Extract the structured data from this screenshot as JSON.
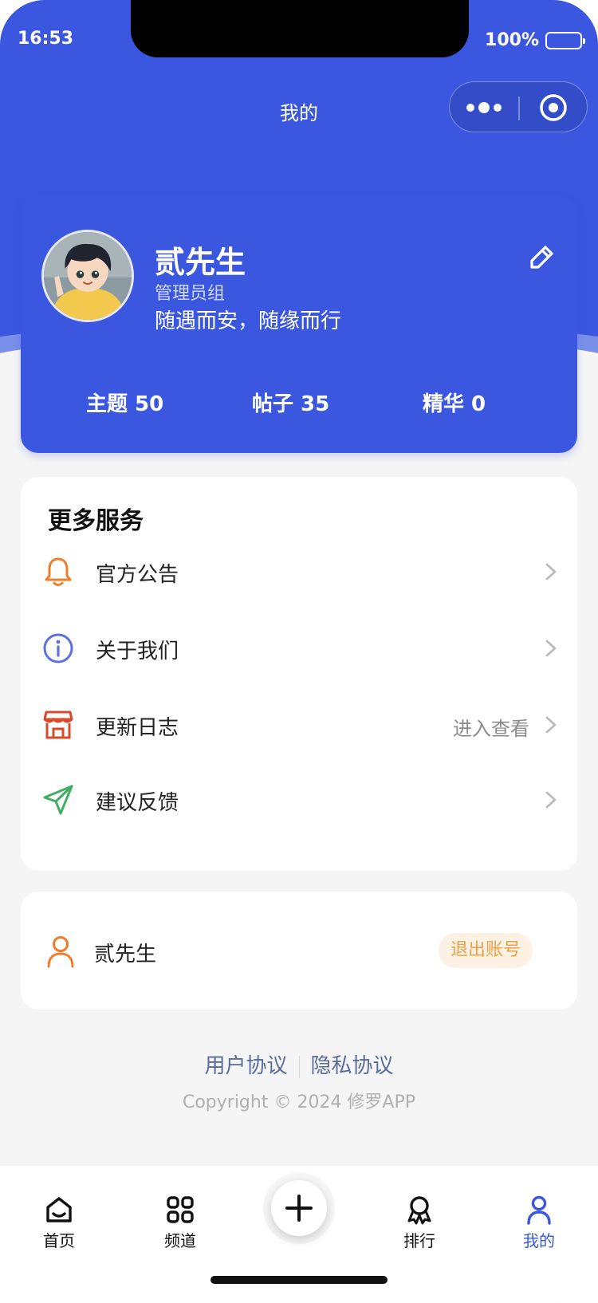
{
  "status_bar": {
    "time": "16:53",
    "battery": "100%"
  },
  "nav": {
    "title": "我的"
  },
  "profile": {
    "name": "贰先生",
    "group": "管理员组",
    "motto": "随遇而安，随缘而行",
    "stats": [
      {
        "label": "主题 50"
      },
      {
        "label": "帖子 35"
      },
      {
        "label": "精华 0"
      }
    ]
  },
  "services": {
    "title": "更多服务",
    "items": [
      {
        "label": "官方公告",
        "extra": "",
        "icon": "bell-icon",
        "color": "#f07c2a"
      },
      {
        "label": "关于我们",
        "extra": "",
        "icon": "info-icon",
        "color": "#5b70e3"
      },
      {
        "label": "更新日志",
        "extra": "进入查看",
        "icon": "store-icon",
        "color": "#d84a2a"
      },
      {
        "label": "建议反馈",
        "extra": "",
        "icon": "send-icon",
        "color": "#3fae62"
      }
    ]
  },
  "account": {
    "name": "贰先生",
    "logout_label": "退出账号"
  },
  "footer": {
    "user_agreement": "用户协议",
    "privacy_agreement": "隐私协议",
    "copyright": "Copyright © 2024 修罗APP"
  },
  "tabbar": {
    "items": [
      {
        "label": "首页",
        "icon": "home-icon"
      },
      {
        "label": "频道",
        "icon": "grid-icon"
      },
      {
        "label": "",
        "icon": "plus-icon"
      },
      {
        "label": "排行",
        "icon": "award-icon"
      },
      {
        "label": "我的",
        "icon": "user-icon"
      }
    ]
  },
  "colors": {
    "brand": "#3b57e0",
    "accent_orange": "#eba148"
  }
}
